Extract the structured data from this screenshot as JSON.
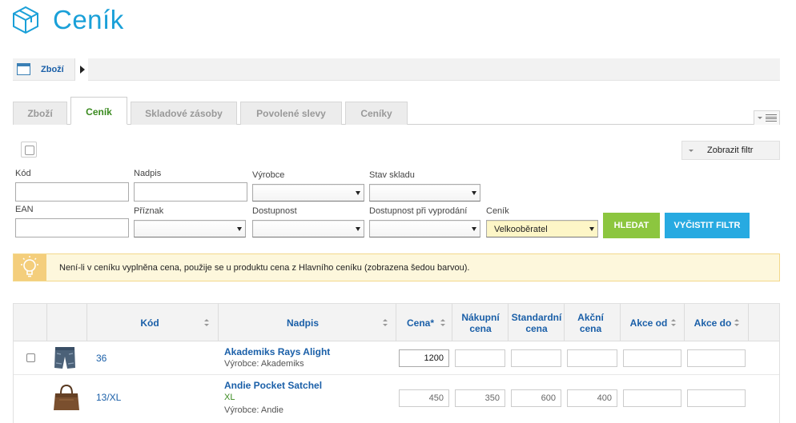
{
  "page": {
    "title": "Ceník",
    "title_icon": "box-icon"
  },
  "breadcrumb": {
    "label": "Zboží",
    "icon": "window-icon"
  },
  "tabs": [
    {
      "label": "Zboží",
      "active": false
    },
    {
      "label": "Ceník",
      "active": true
    },
    {
      "label": "Skladové zásoby",
      "active": false
    },
    {
      "label": "Povolené slevy",
      "active": false
    },
    {
      "label": "Ceníky",
      "active": false
    }
  ],
  "filter": {
    "show_filter_label": "Zobrazit filtr",
    "labels": {
      "code": "Kód",
      "title": "Nadpis",
      "maker": "Výrobce",
      "stock_state": "Stav skladu",
      "ean": "EAN",
      "flag": "Příznak",
      "availability": "Dostupnost",
      "availability_sold_out": "Dostupnost při vyprodání",
      "pricelist": "Ceník"
    },
    "pricelist_value": "Velkooběratel",
    "search_label": "HLEDAT",
    "clear_label": "VYČISTIT FILTR"
  },
  "info": {
    "text": "Není-li v ceníku vyplněna cena, použije se u produktu cena z Hlavního ceníku (zobrazena šedou barvou).",
    "icon": "lightbulb-icon"
  },
  "table": {
    "headers": {
      "code": "Kód",
      "title": "Nadpis",
      "price": "Cena*",
      "purchase_price": "Nákupní cena",
      "standard_price": "Standardní cena",
      "sale_price": "Akční cena",
      "promo_from": "Akce od",
      "promo_to": "Akce do"
    },
    "rows": [
      {
        "code": "36",
        "title": "Akademiks Rays Alight",
        "variant": "",
        "maker": "Výrobce: Akademiks",
        "price": "1200",
        "purchase_price": "",
        "standard_price": "",
        "sale_price": "",
        "thumb": "jeans-shorts-thumbnail"
      },
      {
        "code": "13/XL",
        "title": "Andie Pocket Satchel",
        "variant": "XL",
        "maker": "Výrobce: Andie",
        "price": "450",
        "purchase_price": "350",
        "standard_price": "600",
        "sale_price": "400",
        "thumb": "satchel-bag-thumbnail"
      }
    ]
  },
  "colors": {
    "accent": "#1aa0d8",
    "link": "#1a5fa8",
    "active_tab": "#3a8a1f",
    "search_btn": "#8cc63f",
    "clear_btn": "#27aae1"
  }
}
